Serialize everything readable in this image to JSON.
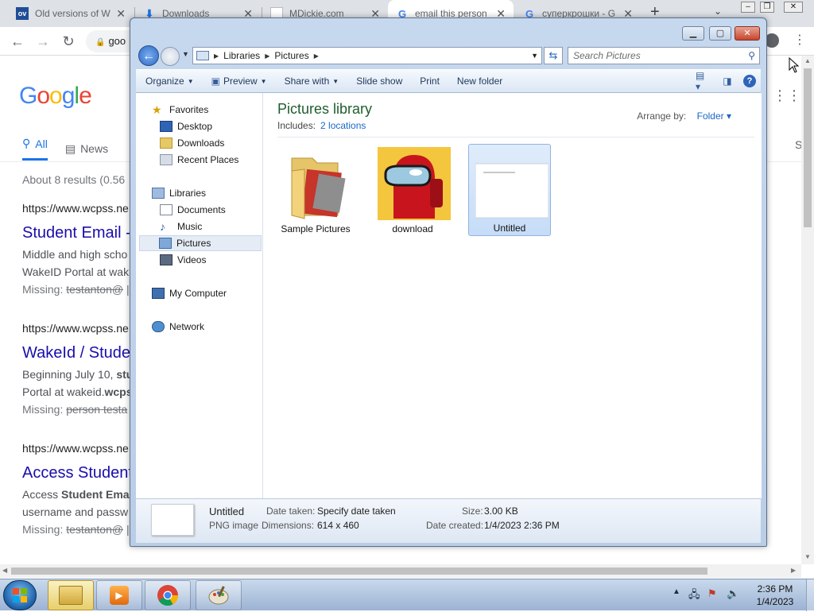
{
  "browser": {
    "tabs": [
      {
        "title": "Old versions of W",
        "favicon": "ov-icon",
        "favicon_text": "ov",
        "active": false
      },
      {
        "title": "Downloads",
        "favicon": "download-icon",
        "active": false
      },
      {
        "title": "MDickie.com",
        "favicon": "page-icon",
        "active": false
      },
      {
        "title": "email this person",
        "favicon": "google-icon",
        "active": true
      },
      {
        "title": "суперкрошки - G",
        "favicon": "google-icon",
        "active": false
      }
    ],
    "new_tab": "+",
    "address": "goo",
    "google": {
      "logo": "Google",
      "tabs": [
        {
          "label": "All",
          "icon": "search-icon"
        },
        {
          "label": "News",
          "icon": "news-icon"
        }
      ],
      "right_tab": "S",
      "stats": "About 8 results (0.56",
      "results": [
        {
          "url": "https://www.wcpss.ne",
          "title": "Student Email -",
          "snippet1": "Middle and high scho",
          "snippet2": "WakeID Portal at wak",
          "missing_label": "Missing:",
          "missing_struck": "testanton@",
          "missing_rest": " |"
        },
        {
          "url": "https://www.wcpss.ne",
          "title": "WakeId / Stude",
          "snippet1_pre": "Beginning July 10, ",
          "snippet1_bold": "stu",
          "snippet2_pre": "Portal at wakeid.",
          "snippet2_bold": "wcps",
          "missing_label": "Missing:",
          "missing_struck": "person",
          "missing_rest": " testa"
        },
        {
          "url": "https://www.wcpss.ne",
          "title": "Access Student",
          "snippet1_pre": "Access ",
          "snippet1_bold": "Student Email",
          "snippet2": "username and passw",
          "missing_label": "Missing:",
          "missing_struck": "testanton@",
          "missing_rest": " |"
        }
      ]
    }
  },
  "explorer": {
    "breadcrumb": [
      "Libraries",
      "Pictures"
    ],
    "search_placeholder": "Search Pictures",
    "commands": [
      {
        "label": "Organize",
        "dropdown": true
      },
      {
        "label": "Preview",
        "dropdown": true
      },
      {
        "label": "Share with",
        "dropdown": true
      },
      {
        "label": "Slide show",
        "dropdown": false
      },
      {
        "label": "Print",
        "dropdown": false
      },
      {
        "label": "New folder",
        "dropdown": false
      }
    ],
    "nav": {
      "favorites": "Favorites",
      "desktop": "Desktop",
      "downloads": "Downloads",
      "recent": "Recent Places",
      "libraries": "Libraries",
      "documents": "Documents",
      "music": "Music",
      "pictures": "Pictures",
      "videos": "Videos",
      "computer": "My Computer",
      "network": "Network"
    },
    "library": {
      "title": "Pictures library",
      "includes_label": "Includes:",
      "includes_link": "2 locations",
      "arrange_label": "Arrange by:",
      "arrange_value": "Folder"
    },
    "items": [
      {
        "label": "Sample Pictures",
        "icon": "folder-icon"
      },
      {
        "label": "download",
        "icon": "among-us-image"
      },
      {
        "label": "Untitled",
        "icon": "blank-image",
        "selected": true
      }
    ],
    "details": {
      "name": "Untitled",
      "type": "PNG image",
      "date_taken_label": "Date taken:",
      "date_taken_value": "Specify date taken",
      "dimensions_label": "Dimensions:",
      "dimensions_value": "614 x 460",
      "size_label": "Size:",
      "size_value": "3.00 KB",
      "created_label": "Date created:",
      "created_value": "1/4/2023 2:36 PM"
    }
  },
  "taskbar": {
    "time": "2:36 PM",
    "date": "1/4/2023",
    "apps": [
      "explorer-icon",
      "media-player-icon",
      "chrome-icon",
      "paint-icon"
    ]
  }
}
